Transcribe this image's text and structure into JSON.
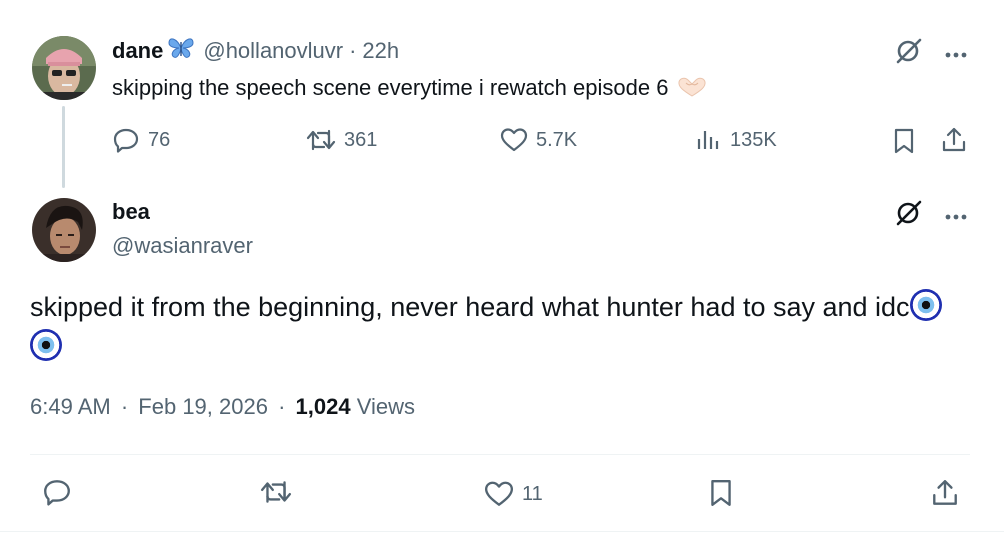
{
  "parent": {
    "name": "dane",
    "handle": "@hollanovluvr",
    "sep": "·",
    "time": "22h",
    "text": "skipping the speech scene everytime i rewatch episode 6",
    "emoji_name": "heart-hands-emoji",
    "stats": {
      "replies": "76",
      "reposts": "361",
      "likes": "5.7K",
      "views": "135K"
    }
  },
  "reply": {
    "name": "bea",
    "handle": "@wasianraver",
    "text": "skipped it from the beginning, never heard what hunter had to say and idc",
    "emoji_name": "nazar-amulet-emoji",
    "time": "6:49 AM",
    "date": "Feb 19, 2026",
    "views_count": "1,024",
    "views_label": "Views",
    "sep": "·",
    "likes": "11"
  },
  "colors": {
    "text": "#0f1419",
    "muted": "#536471",
    "divider": "#eff3f4",
    "butterfly": "#4f8fd8"
  }
}
